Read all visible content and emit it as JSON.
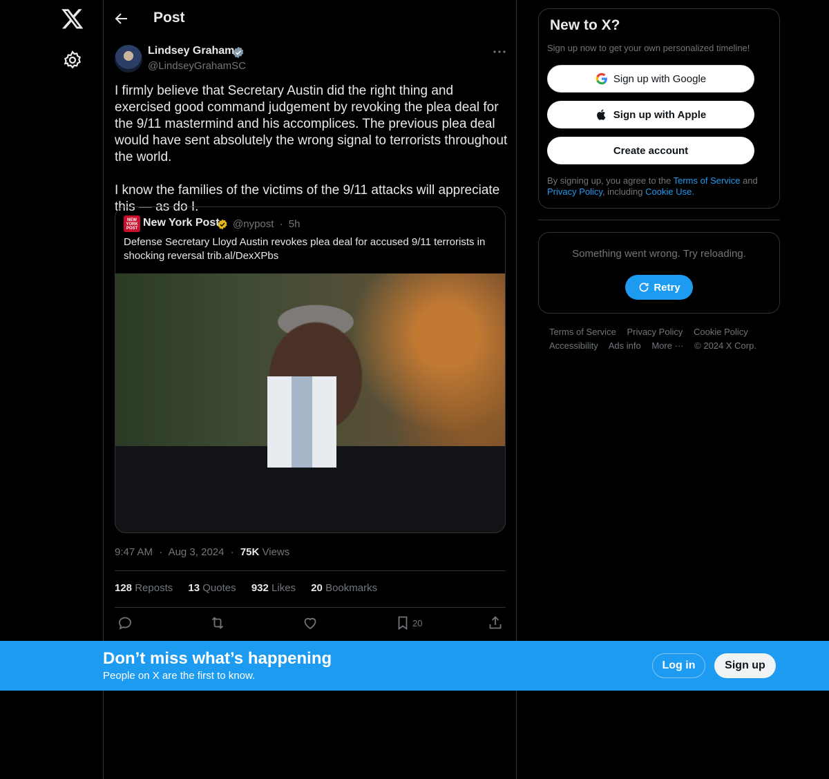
{
  "nav": {
    "logo_icon": "x-logo-icon",
    "settings_icon": "gear-icon"
  },
  "header": {
    "back_icon": "arrow-left-icon",
    "title": "Post"
  },
  "post": {
    "author_name": "Lindsey Graham",
    "author_handle": "@LindseyGrahamSC",
    "verified_icon": "verified-badge-icon",
    "paragraphs": [
      "I firmly believe that Secretary Austin did the right thing and exercised good command judgement by revoking the plea deal for the 9/11 mastermind and his accomplices. The previous plea deal would have sent absolutely the wrong signal to terrorists throughout the world.",
      "I know the families of the victims of the 9/11 attacks will appreciate this — as do I."
    ],
    "quote": {
      "logo_text": "NEW YORK POST",
      "name": "New York Post",
      "handle": "@nypost",
      "time": "5h",
      "separator": "·",
      "text": "Defense Secretary Lloyd Austin revokes plea deal for accused 9/11 terrorists in shocking reversal trib.al/DexXPbs"
    },
    "time": "9:47 AM",
    "date": "Aug 3, 2024",
    "views_count": "75K",
    "views_label": "Views",
    "dot": "·",
    "stats": {
      "reposts_count": "128",
      "reposts_label": "Reposts",
      "quotes_count": "13",
      "quotes_label": "Quotes",
      "likes_count": "932",
      "likes_label": "Likes",
      "bookmarks_count": "20",
      "bookmarks_label": "Bookmarks"
    },
    "actions": {
      "bookmark_count": "20"
    }
  },
  "sidebar": {
    "signup_title": "New to X?",
    "signup_sub": "Sign up now to get your own personalized timeline!",
    "google_label": "Sign up with Google",
    "apple_label": "Sign up with Apple",
    "create_label": "Create account",
    "legal_prefix": "By signing up, you agree to the",
    "terms_link": "Terms of Service",
    "legal_and": "and",
    "privacy_link": "Privacy Policy",
    "legal_including": ", including",
    "cookie_link": "Cookie Use.",
    "error_text": "Something went wrong. Try reloading.",
    "retry_label": "Retry",
    "footer": [
      "Terms of Service",
      "Privacy Policy",
      "Cookie Policy",
      "Accessibility",
      "Ads info",
      "More ···",
      "© 2024 X Corp."
    ]
  },
  "banner": {
    "title": "Don’t miss what’s happening",
    "subtitle": "People on X are the first to know.",
    "login_label": "Log in",
    "signup_label": "Sign up"
  },
  "colors": {
    "accent": "#1d9bf0",
    "background": "#000000",
    "border": "#2f3336",
    "muted_text": "#71767b",
    "verified_gold": "#e2b719"
  }
}
